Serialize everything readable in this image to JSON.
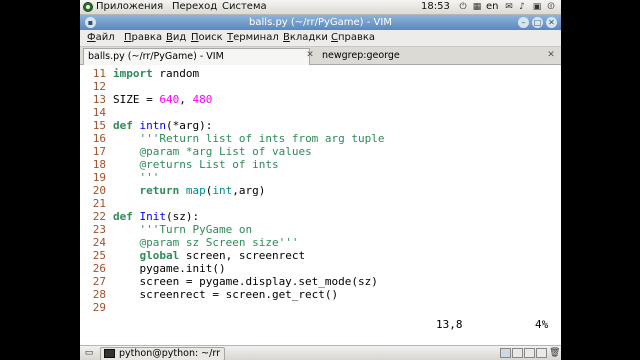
{
  "panel": {
    "apps_menu": "Приложения",
    "places_menu": "Переход",
    "system_menu": "Система",
    "clock": "18:53",
    "keyboard_layout": "en"
  },
  "window": {
    "title": "balls.py (~/rr/PyGame) - VIM"
  },
  "menubar": {
    "items": [
      "Файл",
      "Правка",
      "Вид",
      "Поиск",
      "Терминал",
      "Вкладки",
      "Справка"
    ]
  },
  "tabs": [
    {
      "label": "balls.py (~/rr/PyGame) - VIM",
      "active": true
    },
    {
      "label": "newgrep:george",
      "active": false
    }
  ],
  "editor": {
    "lines": [
      {
        "num": "11",
        "text": "import random"
      },
      {
        "num": "12",
        "text": ""
      },
      {
        "num": "13",
        "text": "SIZE = 640, 480"
      },
      {
        "num": "14",
        "text": ""
      },
      {
        "num": "15",
        "text": "def intn(*arg):"
      },
      {
        "num": "16",
        "text": "    '''Return list of ints from arg tuple"
      },
      {
        "num": "17",
        "text": "    @param *arg List of values"
      },
      {
        "num": "18",
        "text": "    @returns List of ints"
      },
      {
        "num": "19",
        "text": "    '''"
      },
      {
        "num": "20",
        "text": "    return map(int,arg)"
      },
      {
        "num": "21",
        "text": ""
      },
      {
        "num": "22",
        "text": "def Init(sz):"
      },
      {
        "num": "23",
        "text": "    '''Turn PyGame on"
      },
      {
        "num": "24",
        "text": "    @param sz Screen size'''"
      },
      {
        "num": "25",
        "text": "    global screen, screenrect"
      },
      {
        "num": "26",
        "text": "    pygame.init()"
      },
      {
        "num": "27",
        "text": "    screen = pygame.display.set_mode(sz)"
      },
      {
        "num": "28",
        "text": "    screenrect = screen.get_rect()"
      },
      {
        "num": "29",
        "text": ""
      }
    ],
    "cursor_position": "13,8",
    "scroll_percent": "4%"
  },
  "taskbar": {
    "task_label": "python@python: ~/rr"
  },
  "colors": {
    "titlebar": "#6f9bcb",
    "line_number": "#a0522d",
    "keyword": "#a020f0",
    "string": "#2e8b57",
    "number": "#ff00ff",
    "function_name": "#0000ff"
  }
}
